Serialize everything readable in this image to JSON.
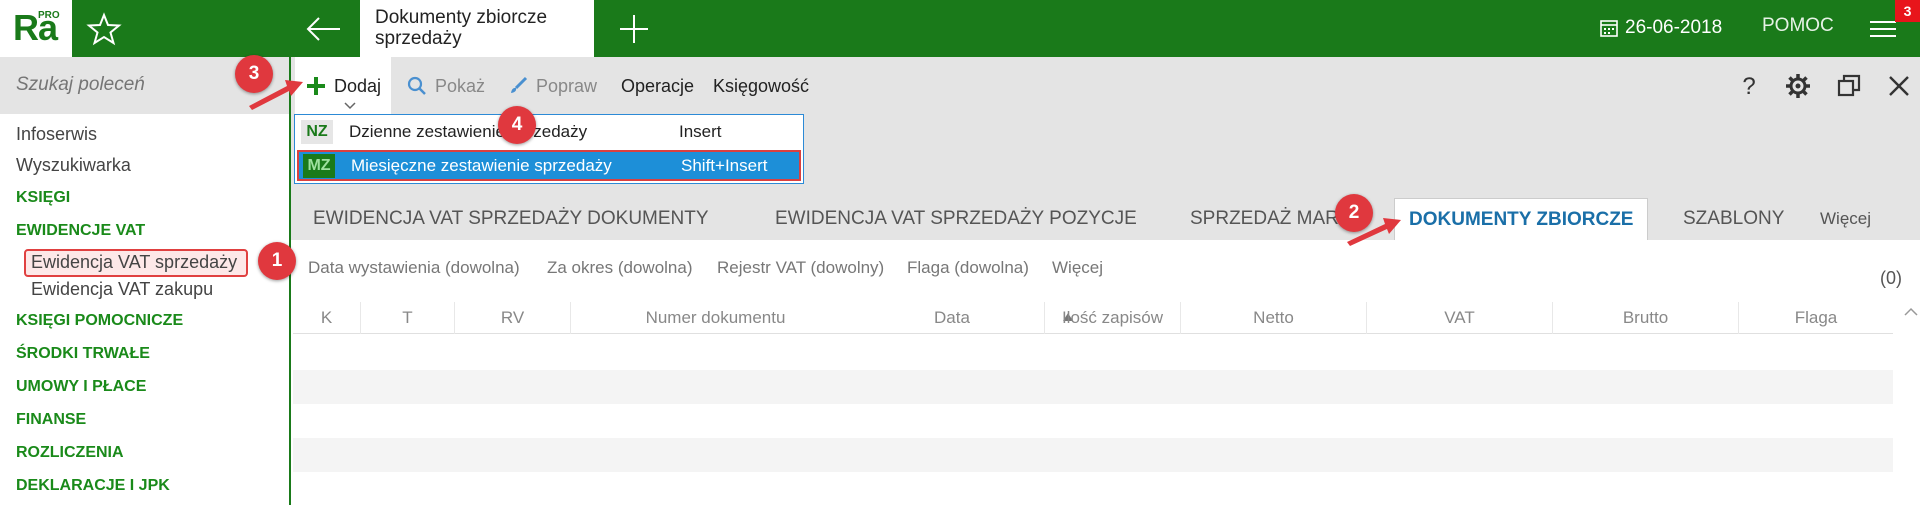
{
  "app": {
    "logo_text": "Ra",
    "logo_badge": "PRO",
    "window_title_line1": "Dokumenty zbiorcze",
    "window_title_line2": "sprzedaży",
    "date": "26-06-2018",
    "help_label": "POMOC",
    "notification_count": "3"
  },
  "sidebar": {
    "search_placeholder": "Szukaj poleceń",
    "items": [
      {
        "label": "Infoserwis"
      },
      {
        "label": "Wyszukiwarka"
      },
      {
        "label": "KSIĘGI"
      },
      {
        "label": "EWIDENCJE VAT"
      },
      {
        "label": "Ewidencja VAT sprzedaży"
      },
      {
        "label": "Ewidencja VAT zakupu"
      },
      {
        "label": "KSIĘGI POMOCNICZE"
      },
      {
        "label": "ŚRODKI TRWAŁE"
      },
      {
        "label": "UMOWY I PŁACE"
      },
      {
        "label": "FINANSE"
      },
      {
        "label": "ROZLICZENIA"
      },
      {
        "label": "DEKLARACJE I JPK"
      }
    ]
  },
  "toolbar": {
    "add_label": "Dodaj",
    "show_label": "Pokaż",
    "edit_label": "Popraw",
    "operations_label": "Operacje",
    "accounting_label": "Księgowość"
  },
  "dropdown": {
    "items": [
      {
        "code": "NZ",
        "label": "Dzienne zestawienie sprzedaży",
        "shortcut": "Insert"
      },
      {
        "code": "MZ",
        "label": "Miesięczne zestawienie sprzedaży",
        "shortcut": "Shift+Insert"
      }
    ]
  },
  "tabs": [
    {
      "label": "EWIDENCJA VAT SPRZEDAŻY DOKUMENTY"
    },
    {
      "label": "EWIDENCJA VAT SPRZEDAŻY POZYCJE"
    },
    {
      "label": "SPRZEDAŻ MARŻA"
    },
    {
      "label": "DOKUMENTY ZBIORCZE"
    },
    {
      "label": "SZABLONY"
    },
    {
      "label": "Więcej"
    }
  ],
  "filters": [
    {
      "label": "Data wystawienia (dowolna)"
    },
    {
      "label": "Za okres (dowolna)"
    },
    {
      "label": "Rejestr VAT (dowolny)"
    },
    {
      "label": "Flaga (dowolna)"
    },
    {
      "label": "Więcej"
    }
  ],
  "record_count": "(0)",
  "table": {
    "columns": [
      "K",
      "T",
      "RV",
      "Numer dokumentu",
      "Data",
      "Ilość zapisów",
      "Netto",
      "VAT",
      "Brutto",
      "Flaga"
    ],
    "rows": []
  },
  "annotations": [
    "1",
    "2",
    "3",
    "4"
  ],
  "colors": {
    "brand_green": "#1a7a1a",
    "accent_blue": "#1d8fd8",
    "active_tab": "#1a6fa8",
    "annotation_red": "#e0383e"
  }
}
